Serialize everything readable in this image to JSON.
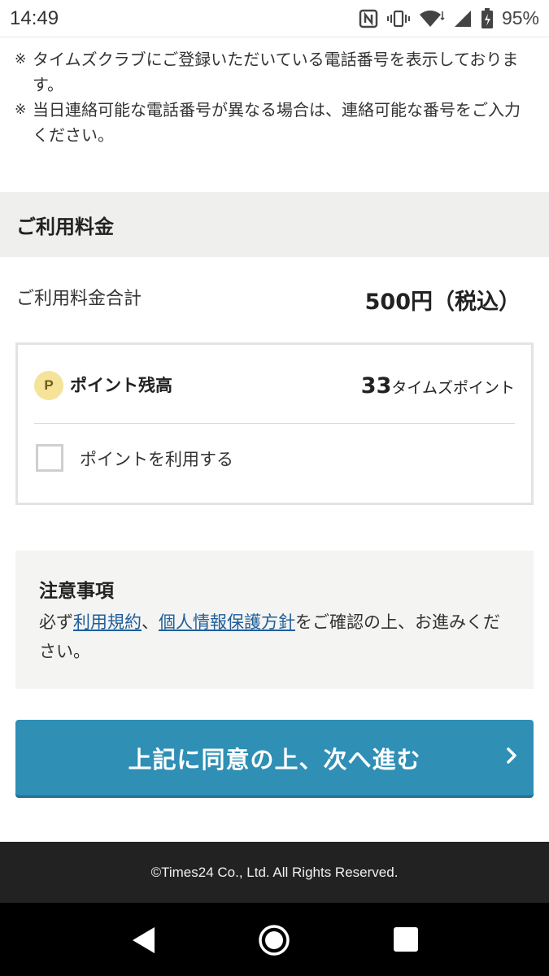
{
  "status_bar": {
    "time": "14:49",
    "battery_percent": "95%",
    "icons": [
      "nfc-icon",
      "vibrate-icon",
      "wifi-icon",
      "signal-icon",
      "battery-icon"
    ]
  },
  "notes": [
    "タイムズクラブにご登録いただいている電話番号を表示しております。",
    "当日連絡可能な電話番号が異なる場合は、連絡可能な番号をご入力ください。"
  ],
  "note_mark": "※",
  "section": {
    "title": "ご利用料金"
  },
  "fee": {
    "label": "ご利用料金合計",
    "value": "500円（税込）"
  },
  "points": {
    "badge": "P",
    "label": "ポイント残高",
    "amount": "33",
    "unit": "タイムズポイント",
    "checkbox_label": "ポイントを利用する",
    "checkbox_checked": false
  },
  "notice": {
    "title": "注意事項",
    "prefix": "必ず",
    "link_terms": "利用規約",
    "separator": "、",
    "link_privacy": "個人情報保護方針",
    "suffix": "をご確認の上、お進みください。"
  },
  "next_button": {
    "label": "上記に同意の上、次へ進む"
  },
  "footer": {
    "copyright": "©Times24 Co., Ltd. All Rights Reserved."
  },
  "colors": {
    "primary_button": "#2f8fb5",
    "link": "#1f5e9b",
    "section_bg": "#efefed",
    "footer_bg": "#222222"
  }
}
